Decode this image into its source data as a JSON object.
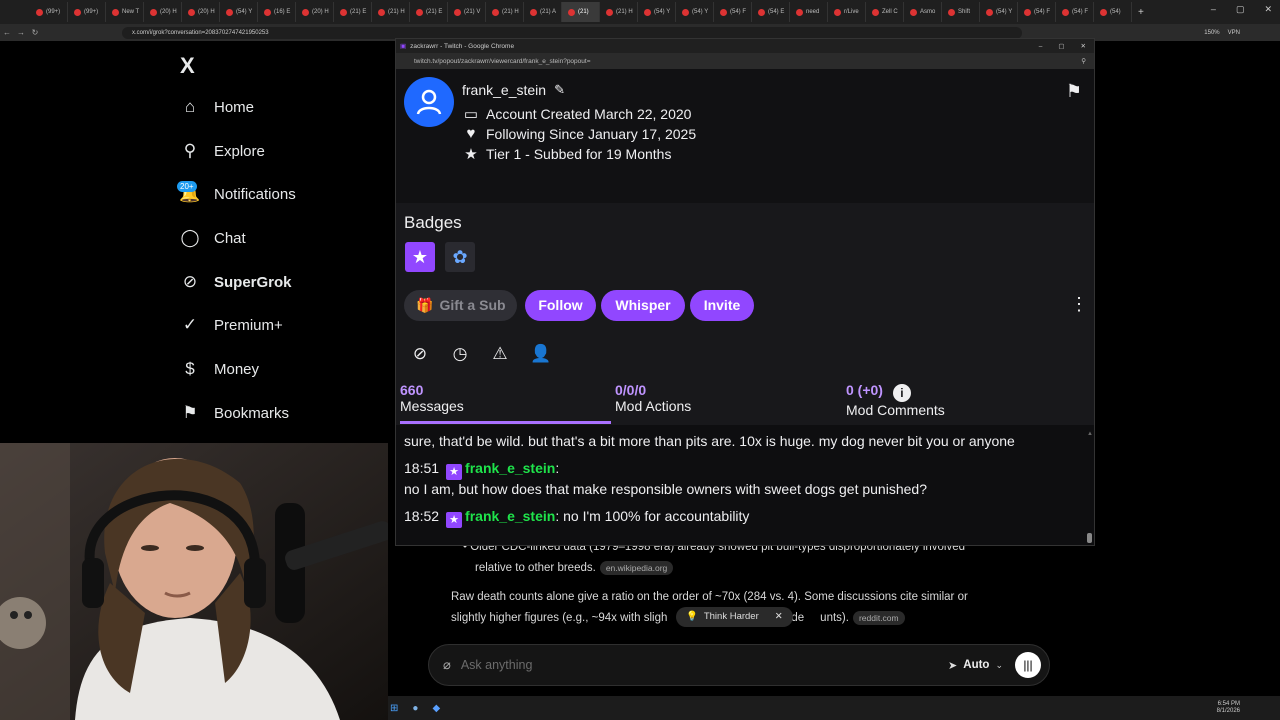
{
  "browser": {
    "tabs": [
      "(99+)",
      "(99+)",
      "New T",
      "(20) H",
      "(20) H",
      "(54) Y",
      "(16) E",
      "(20) H",
      "(21) E",
      "(21) H",
      "(21) E",
      "(21) V",
      "(21) H",
      "(21) A",
      "(21)",
      "(21) H",
      "(54) Y",
      "(54) Y",
      "(54) F",
      "(54) E",
      "need",
      "r/Live",
      "Zell C",
      "Asmo",
      "Shift",
      "(54) Y",
      "(54) F",
      "(54) F",
      "(54)"
    ],
    "active_tab_index": 14,
    "url": "x.com/i/grok?conversation=2083702747421950253",
    "zoom": "150%",
    "vpn_label": "VPN"
  },
  "x_sidebar": {
    "logo": "X",
    "notification_count": "20+",
    "items": [
      {
        "label": "Home",
        "icon": "home-icon",
        "glyph": "⌂"
      },
      {
        "label": "Explore",
        "icon": "search-icon",
        "glyph": "⚲"
      },
      {
        "label": "Notifications",
        "icon": "bell-icon",
        "glyph": "🔔"
      },
      {
        "label": "Chat",
        "icon": "chat-bubble-icon",
        "glyph": "◯"
      },
      {
        "label": "SuperGrok",
        "icon": "grok-icon",
        "glyph": "⊘"
      },
      {
        "label": "Premium+",
        "icon": "verified-icon",
        "glyph": "✓"
      },
      {
        "label": "Money",
        "icon": "dollar-icon",
        "glyph": "$"
      },
      {
        "label": "Bookmarks",
        "icon": "bookmark-icon",
        "glyph": "⚑"
      }
    ]
  },
  "grok": {
    "bullet_text": "Older CDC-linked data (1979–1998 era) already showed pit bull-types disproportionately involved",
    "bullet_text_2": "relative to other breeds.",
    "source_1": "en.wikipedia.org",
    "para_1a": "Raw death counts alone give a ratio on the order of ~70x (284 vs. 4). Some discussions cite similar or",
    "para_1b": "slightly higher figures (e.g., ~94x with sligh",
    "para_1c": "de",
    "para_1d": "unts).",
    "source_2": "reddit.com",
    "think_harder": "Think Harder",
    "ask_placeholder": "Ask anything",
    "mode": "Auto"
  },
  "popup": {
    "window_title": "zackrawrr - Twitch - Google Chrome",
    "url": "twitch.tv/popout/zackrawrr/viewercard/frank_e_stein?popout=",
    "username": "frank_e_stein",
    "account_created": "Account Created March 22, 2020",
    "following_since": "Following Since January 17, 2025",
    "sub_tier": "Tier 1 - Subbed for 19 Months",
    "badges_title": "Badges",
    "actions": {
      "gift": "Gift a Sub",
      "follow": "Follow",
      "whisper": "Whisper",
      "invite": "Invite"
    },
    "stats": [
      {
        "value": "660",
        "label": "Messages"
      },
      {
        "value": "0/0/0",
        "label": "Mod Actions"
      },
      {
        "value": "0 (+0)",
        "label": "Mod Comments"
      }
    ],
    "chat": [
      {
        "time": "",
        "user": "",
        "text": "sure, that'd be wild. but that's a bit more than pits are. 10x is huge. my dog never bit you or anyone"
      },
      {
        "time": "18:51",
        "user": "frank_e_stein",
        "text": ":"
      },
      {
        "time": "",
        "user": "",
        "text": "no I am, but how does that make responsible owners with sweet dogs get punished?"
      },
      {
        "time": "18:52",
        "user": "frank_e_stein",
        "text": ": no I'm 100% for accountability"
      }
    ]
  },
  "taskbar": {
    "time": "6:54 PM",
    "date": "8/1/2026"
  },
  "colors": {
    "twitch_purple": "#9147ff",
    "username_green": "#1fe34b",
    "x_blue": "#1d9bf0"
  }
}
